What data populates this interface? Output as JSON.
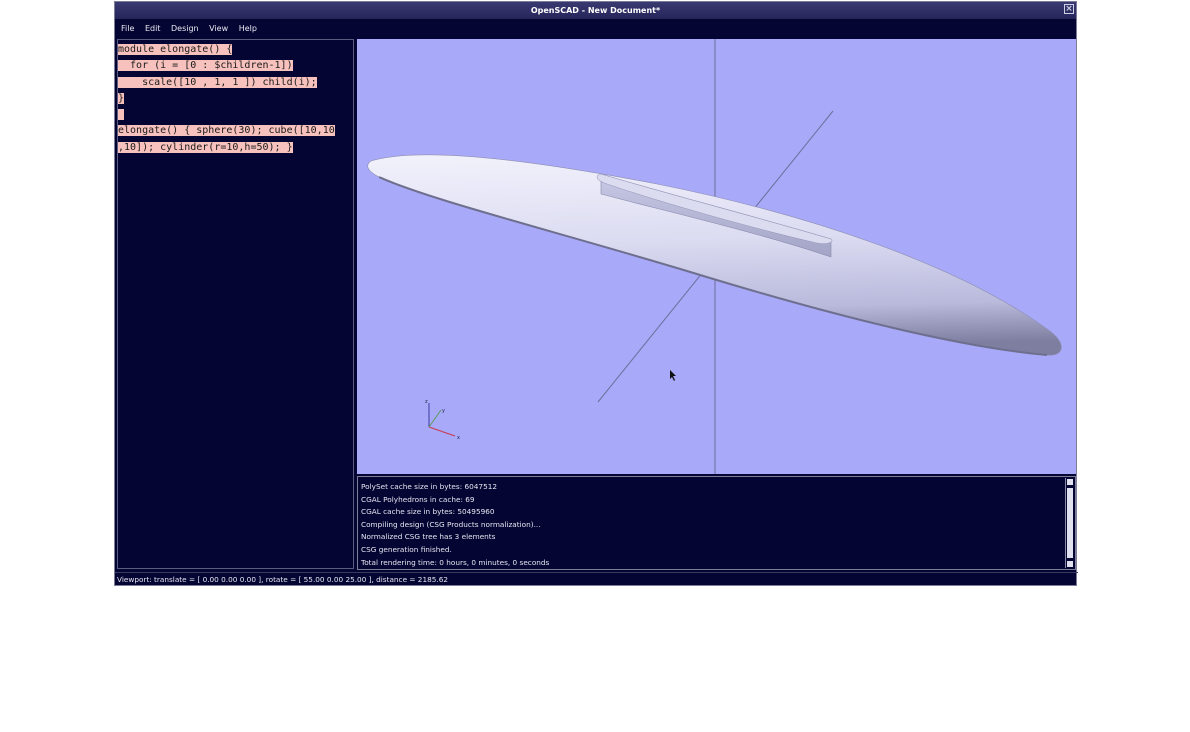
{
  "window": {
    "title": "OpenSCAD - New Document*"
  },
  "menu": {
    "items": [
      "File",
      "Edit",
      "Design",
      "View",
      "Help"
    ]
  },
  "editor": {
    "lines": [
      "module elongate() {",
      "  for (i = [0 : $children-1])",
      "    scale([10 , 1, 1 ]) child(i);",
      "}",
      "",
      "elongate() { sphere(30); cube([10,10",
      ",10]); cylinder(r=10,h=50); }"
    ]
  },
  "viewport": {
    "background": "#a8a9f8",
    "axis_labels": {
      "z": "z",
      "y": "y",
      "x": "x"
    }
  },
  "console": {
    "lines": [
      "PolySet cache size in bytes: 6047512",
      "CGAL Polyhedrons in cache: 69",
      "CGAL cache size in bytes: 50495960",
      "Compiling design (CSG Products normalization)...",
      "Normalized CSG tree has 3 elements",
      "CSG generation finished.",
      "Total rendering time: 0 hours, 0 minutes, 0 seconds"
    ]
  },
  "status": {
    "text": "Viewport: translate = [ 0.00 0.00 0.00 ], rotate = [ 55.00 0.00 25.00 ], distance = 2185.62"
  },
  "colors": {
    "window_bg": "#050533",
    "selection": "#f7c2bd",
    "model_fill": "#d6d7f2",
    "model_shadow": "#6e6f8e"
  }
}
